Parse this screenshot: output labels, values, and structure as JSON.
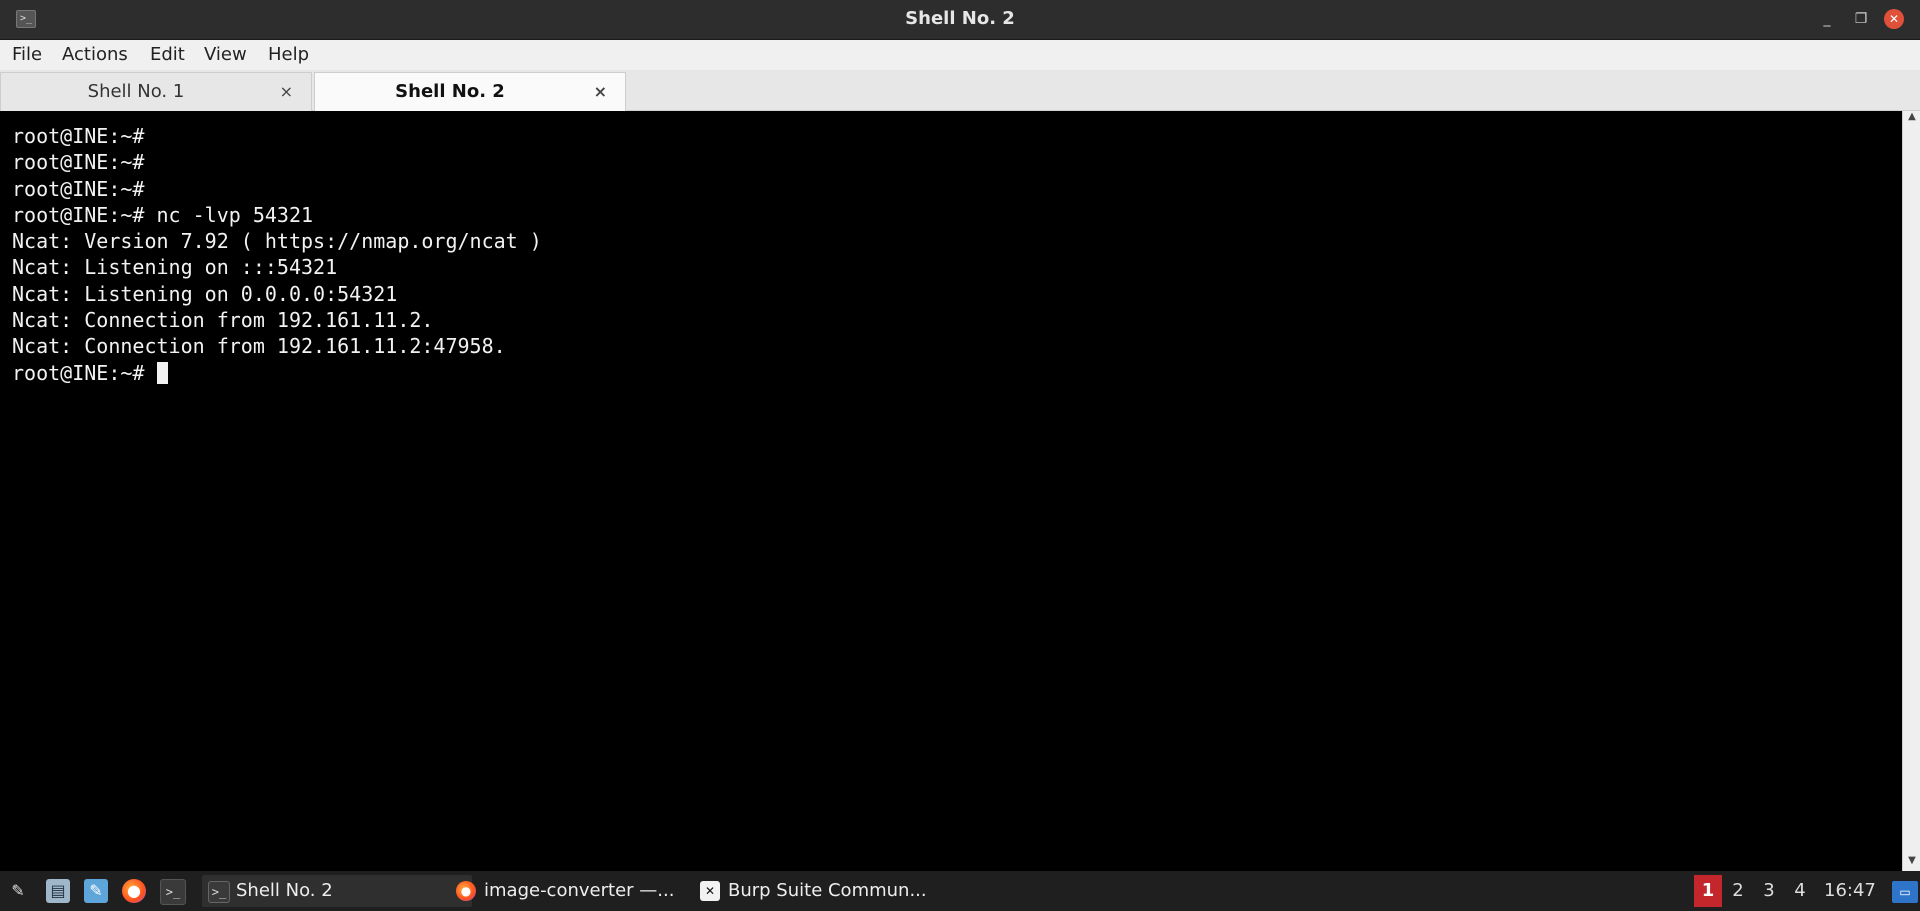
{
  "window": {
    "title": "Shell No. 2",
    "app_icon_glyph": ">_",
    "controls": {
      "minimize_glyph": "_",
      "maximize_glyph": "❐",
      "close_glyph": "✕"
    }
  },
  "menu": {
    "items": [
      "File",
      "Actions",
      "Edit",
      "View",
      "Help"
    ]
  },
  "tabs": [
    {
      "label": "Shell No. 1",
      "close": "×",
      "active": false
    },
    {
      "label": "Shell No. 2",
      "close": "×",
      "active": true
    }
  ],
  "terminal": {
    "lines": [
      "root@INE:~#",
      "root@INE:~#",
      "root@INE:~#",
      "root@INE:~# nc -lvp 54321",
      "Ncat: Version 7.92 ( https://nmap.org/ncat )",
      "Ncat: Listening on :::54321",
      "Ncat: Listening on 0.0.0.0:54321",
      "Ncat: Connection from 192.161.11.2.",
      "Ncat: Connection from 192.161.11.2:47958.",
      "root@INE:~# "
    ]
  },
  "scrollbar": {
    "up_glyph": "▲",
    "down_glyph": "▼"
  },
  "taskbar": {
    "launchers": [
      {
        "name": "app-menu-icon",
        "glyph": "✎"
      },
      {
        "name": "files-icon",
        "glyph": "▤"
      },
      {
        "name": "text-editor-icon",
        "glyph": "✎"
      },
      {
        "name": "firefox-icon",
        "glyph": "●"
      },
      {
        "name": "terminal-icon",
        "glyph": ">_"
      }
    ],
    "tasks": [
      {
        "label": "Shell No. 2",
        "icon": "terminal-icon",
        "glyph": ">_",
        "active": true
      },
      {
        "label": "image-converter —...",
        "icon": "firefox-icon",
        "glyph": "●",
        "active": false
      },
      {
        "label": "Burp Suite Commun...",
        "icon": "burp-suite-icon",
        "glyph": "✕",
        "active": false
      }
    ],
    "workspaces": [
      "1",
      "2",
      "3",
      "4"
    ],
    "active_workspace": "1",
    "clock": "16:47",
    "tray_glyph": "▭"
  },
  "colors": {
    "terminal_bg": "#000000",
    "terminal_fg": "#f2f2f2",
    "titlebar_bg": "#2d2d2d",
    "active_workspace": "#c3262b",
    "close_button": "#e0513a"
  }
}
